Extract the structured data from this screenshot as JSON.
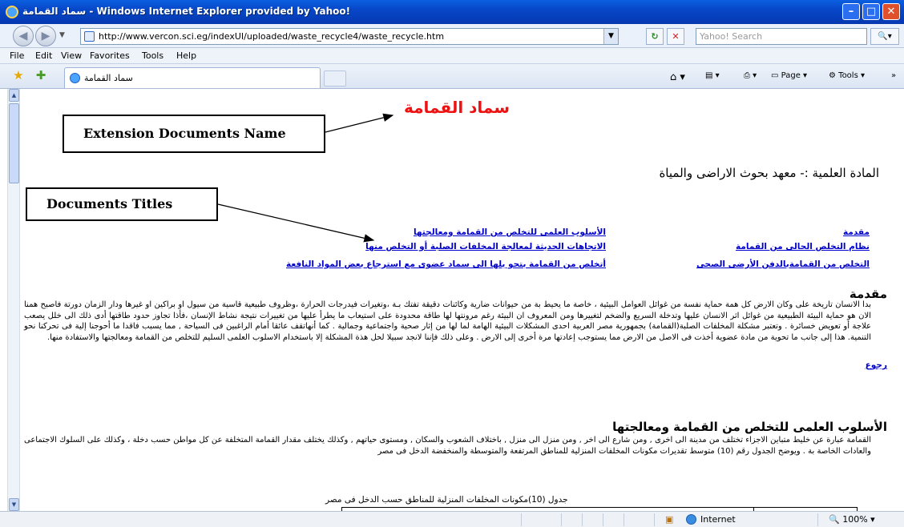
{
  "window": {
    "title": "سماد القمامة - Windows Internet Explorer provided by Yahoo!"
  },
  "address": {
    "url": "http://www.vercon.sci.eg/indexUI/uploaded/waste_recycle4/waste_recycle.htm",
    "search_placeholder": "Yahoo! Search"
  },
  "menu": {
    "items": [
      "File",
      "Edit",
      "View",
      "Favorites",
      "Tools",
      "Help"
    ]
  },
  "tab": {
    "label": "سماد القمامة"
  },
  "toolbar_right": {
    "page_label": "Page",
    "tools_label": "Tools"
  },
  "page": {
    "doc_name": "سماد القمامة",
    "callout_name": "Extension Documents Name",
    "callout_titles": "Documents Titles",
    "subject": "المادة العلمية :- معهد بحوث الاراضى والمياة",
    "links_right": [
      "مقدمة",
      "نظام التخلص الحالى من القمامة",
      "التخلص من القمامةبالدفن الأرضى الصحى"
    ],
    "links_left": [
      "الأسلوب العلمى للتخلص من القمامة ومعالجتها",
      "الاتجاهات الحديثة لمعالجة المخلفات الصلبة أو التخلص منها",
      "أتخلص من القمامة بتحو يلها الى سماد عضوى  مع استرجاع بعض المواد النافعة"
    ],
    "intro_heading": "مقدمة",
    "intro_paragraph": "بدا الانسان تاريخة على وكان الارض كل همة حماية نفسة من غوائل العوامل البيئية ، خاصة ما يحيط بة من حيوانات ضارية وكائنات دقيقة تفتك بـة ،وتغيرات فيدرجات الحرارة ،وظروف طبيعية قاسية من سيول او براكين او غيرها ودار الزمان دورتة فاصبح همنا الان هو حماية البيئة الطبيعية من غوائل اثر الانسان عليها وتدخلة السريع والضخم لتغييرها  ومن المعروف ان البيئة رغم مرونتها لها طاقة محدودة  على  استيعاب ما يطرأ عليها من تغييرات  نتيجة نشاط الإنسان ،فأذا تجاوز حدود طاقتها أدى ذلك الى خلل يصعب علاجة  أو تعويض خسائرة . وتعتبر مشكلة المخلفات الصلبة(القمامة) بجمهورية مصر العربية احدى المشكلات البيئية الهامة لما لها من    إثار صحية واجتماعية وجمالية . كما أنهاتقف عائقا أمام الراغبين فى السياحة , مما يسبب فاقدا ما أحوجنا إلية فى تحركنا نحو التنمية. هذا إلى جانب ما تحوية من مادة عضوية أخذت فى الاصل من الارض مما يستوجب إعادتها مرة أخرى إلى الارض . وعلى ذلك فإننا لانجد سبيلا لحل هذة المشكلة إلا باستخدام الاسلوب العلمى السليم للتخلص من القمامة ومعالجتها والاستفادة منها.",
    "back_link": "رجوع",
    "method_heading": "الأسلوب العلمى للتخلص من القمامة ومعالجتها",
    "method_paragraph": "القمامة عبارة عن خليط متباين الاجزاء تختلف من مدينة الى اخرى , ومن شارع الى اخر , ومن منزل الى منزل , باختلاف الشعوب والسكان , ومستوى حياتهم , وكذلك يختلف مقدار القمامة المتخلفة عن كل مواطن حسب دخلة ، وكذلك على السلوك الاجتماعى والعادات الخاصة بة . ويوضح الجدول رقم (10) متوسط تقديرات مكونات المخلفات المنزلية للمناطق المرتفعة والمتوسطة والمنخفضة الدخل فى مصر",
    "table_caption": "جدول (10)مكونات المخلفات المنزلية للمناطق حسب الدخل فى مصر"
  },
  "status": {
    "zone": "Internet",
    "zoom": "100%"
  }
}
